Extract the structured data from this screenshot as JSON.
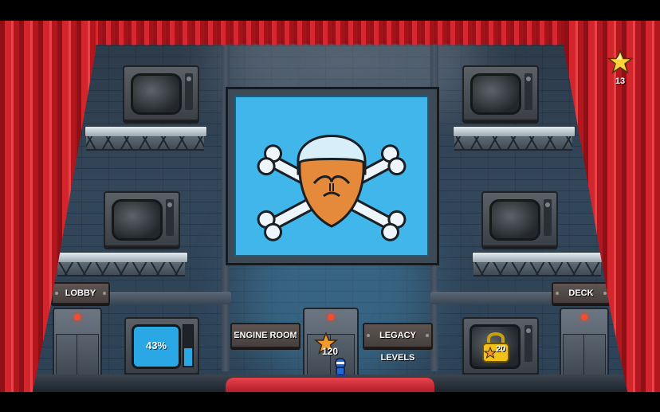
{
  "hud": {
    "stars": "13",
    "star_icon": "star-icon"
  },
  "big_screen": {
    "emblem": "bearded-skull-crossbones-icon",
    "bg_color": "#41b6ea"
  },
  "signs": {
    "lobby": "LOBBY",
    "deck": "DECK",
    "engine_room": "ENGINE ROOM",
    "legacy_levels": "LEGACY LEVELS"
  },
  "progress_tv": {
    "percent_label": "43%",
    "percent": 43
  },
  "locked_tv": {
    "stars_required": "20",
    "icons": [
      "padlock-icon",
      "star-icon"
    ]
  },
  "center_door": {
    "stars_required": "120"
  },
  "colors": {
    "curtain": "#d3252c",
    "screen_blue": "#41b6ea",
    "door_lamp": "#ff4a2a",
    "lock_gold": "#f2c21c"
  }
}
